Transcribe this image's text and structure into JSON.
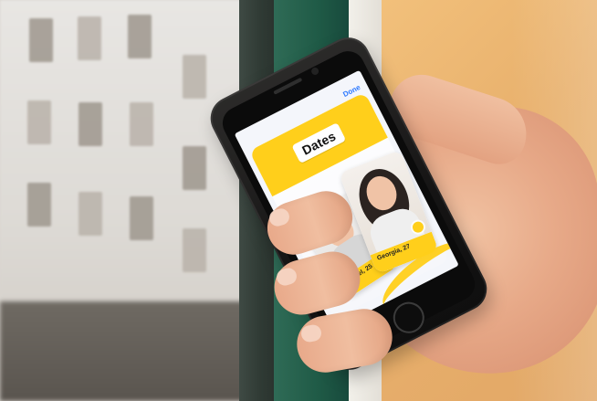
{
  "phone_screen": {
    "top_right_label": "Done",
    "promo_title": "Dates",
    "profiles": [
      {
        "name": "Michael, 25"
      },
      {
        "name": "Georgia, 27"
      }
    ]
  },
  "colors": {
    "bumble_yellow": "#ffcf1b",
    "wall": "#e8b06c",
    "window_frame_green": "#1f5a46"
  }
}
